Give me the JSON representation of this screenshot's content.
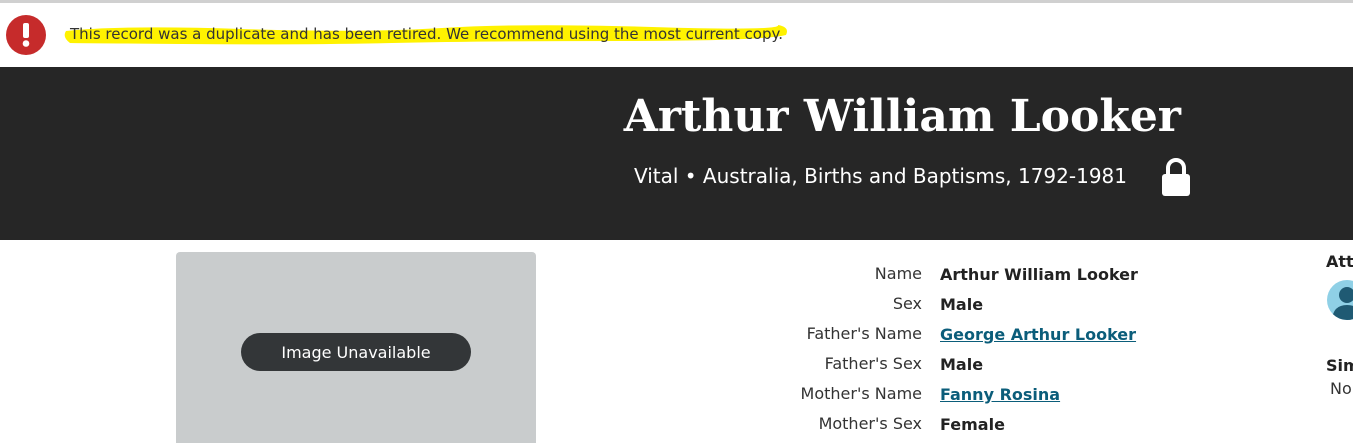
{
  "alert": {
    "icon": "exclamation-icon",
    "message": "This record was a duplicate and has been retired. We recommend using the most current copy.",
    "highlight_color": "#fff200",
    "icon_color": "#c62b2b"
  },
  "record": {
    "title": "Arthur William Looker",
    "subtitle": "Vital • Australia, Births and Baptisms, 1792-1981",
    "lock_icon": "lock-icon"
  },
  "image_panel": {
    "button_label": "Image Unavailable"
  },
  "facts": [
    {
      "label": "Name",
      "value": "Arthur William Looker",
      "link": false
    },
    {
      "label": "Sex",
      "value": "Male",
      "link": false
    },
    {
      "label": "Father's Name",
      "value": "George Arthur Looker",
      "link": true
    },
    {
      "label": "Father's Sex",
      "value": "Male",
      "link": false
    },
    {
      "label": "Mother's Name",
      "value": "Fanny Rosina",
      "link": true
    },
    {
      "label": "Mother's Sex",
      "value": "Female",
      "link": false
    }
  ],
  "side": {
    "heading": "Atta",
    "heading2": "Sim",
    "text": "No"
  },
  "colors": {
    "header_bg": "#262626",
    "link": "#0b5d7a",
    "image_bg": "#c9cccd"
  }
}
